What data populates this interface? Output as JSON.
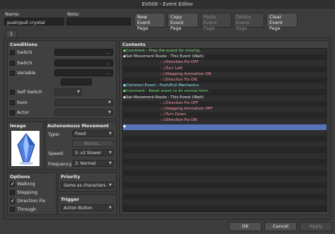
{
  "window": {
    "title": "EV006 - Event Editor"
  },
  "header": {
    "name_label": "Name:",
    "name_value": "push/pull crystal",
    "note_label": "Note:",
    "note_value": "",
    "new_page": "New\nEvent Page",
    "copy_page": "Copy\nEvent Page",
    "paste_page": "Paste\nEvent Page",
    "delete_page": "Delete\nEvent Page",
    "clear_page": "Clear\nEvent Page"
  },
  "tab": {
    "label": "1"
  },
  "conditions": {
    "title": "Conditions",
    "switch1": "Switch",
    "switch2": "Switch",
    "variable": "Variable",
    "self_switch": "Self Switch",
    "item": "Item",
    "actor": "Actor",
    "ellipsis": "..."
  },
  "image": {
    "title": "Image"
  },
  "movement": {
    "title": "Autonomous Movement",
    "type_label": "Type:",
    "type_value": "Fixed",
    "route_button": "Route...",
    "speed_label": "Speed:",
    "speed_value": "3: x2 Slower",
    "freq_label": "Frequency:",
    "freq_value": "3: Normal"
  },
  "options": {
    "title": "Options",
    "walking": "Walking",
    "stepping": "Stepping",
    "direction_fix": "Direction Fix",
    "through": "Through",
    "walking_checked": true,
    "stepping_checked": false,
    "direction_fix_checked": true,
    "through_checked": false
  },
  "priority": {
    "title": "Priority",
    "value": "Same as characters"
  },
  "trigger": {
    "title": "Trigger",
    "value": "Action Button"
  },
  "contents": {
    "title": "Contents",
    "lines": [
      {
        "text": "◆Comment : Prep the event for moving.",
        "color": "#7fe07f"
      },
      {
        "text": "◆Set Movement Route : This Event (Wait)",
        "color": "#e8e8e8"
      },
      {
        "text": "                              : ◇Direction Fix OFF",
        "color": "#ff9aa8"
      },
      {
        "text": "                              : ◇Turn Left",
        "color": "#ff9aa8"
      },
      {
        "text": "                              : ◇Stepping Animation ON",
        "color": "#ff9aa8"
      },
      {
        "text": "                              : ◇Direction Fix ON",
        "color": "#ff9aa8"
      },
      {
        "text": "◆Common Event : Push/Pull Mechanics",
        "color": "#8ee8ff"
      },
      {
        "text": "◆Comment : Reset event to its normal form.",
        "color": "#7fe07f"
      },
      {
        "text": "◆Set Movement Route : This Event (Wait)",
        "color": "#e8e8e8"
      },
      {
        "text": "                              : ◇Direction Fix OFF",
        "color": "#ff9aa8"
      },
      {
        "text": "                              : ◇Stepping Animation OFF",
        "color": "#ff9aa8"
      },
      {
        "text": "                              : ◇Turn Down",
        "color": "#ff9aa8"
      },
      {
        "text": "                              : ◇Direction Fix ON",
        "color": "#ff9aa8"
      },
      {
        "text": "◆",
        "color": "#ffffff"
      }
    ]
  },
  "footer": {
    "ok": "OK",
    "cancel": "Cancel",
    "apply": "Apply"
  },
  "colors": {
    "selection": "#5874b8",
    "comment": "#7fe07f",
    "route_step": "#ff9aa8",
    "common_event": "#8ee8ff"
  }
}
